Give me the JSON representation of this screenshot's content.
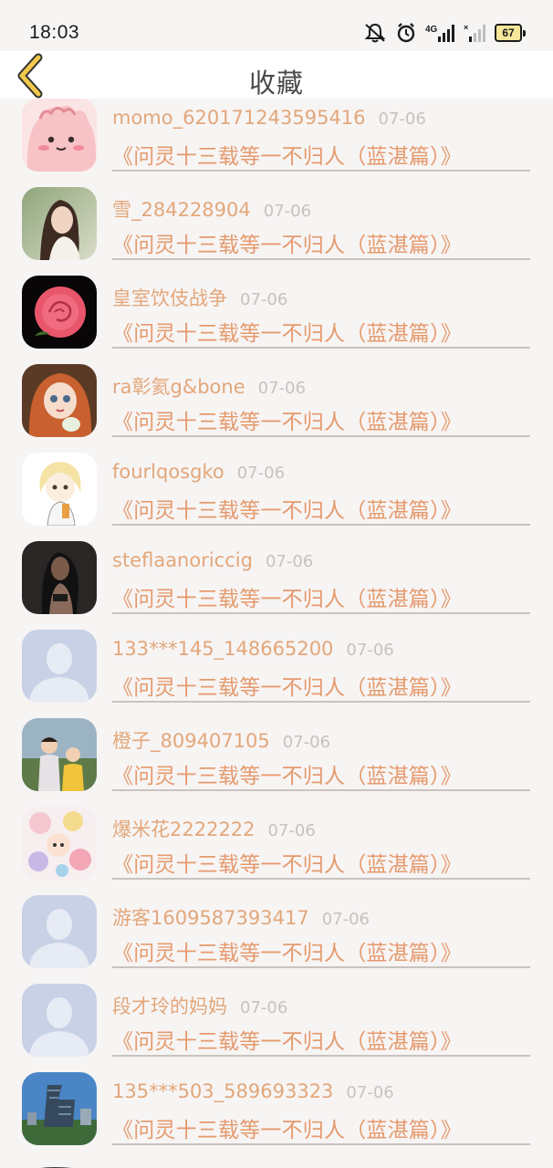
{
  "status_bar": {
    "time": "18:03",
    "battery": "67",
    "icons": [
      "mute-bell-icon",
      "alarm-icon",
      "signal-4g-icon",
      "signal-x-icon",
      "battery-icon"
    ]
  },
  "header": {
    "title": "收藏",
    "back_icon": "chevron-left-icon"
  },
  "colors": {
    "accent": "#e59a6d",
    "date": "#c7c2c0",
    "background": "#f7f4f4",
    "back_icon": "#f2c94c"
  },
  "items": [
    {
      "user": "momo_620171243595416",
      "date": "07-06",
      "title": "《问灵十三载等一不归人（蓝湛篇）》",
      "avatar": "pink-blob-avatar"
    },
    {
      "user": "雪_284228904",
      "date": "07-06",
      "title": "《问灵十三载等一不归人（蓝湛篇）》",
      "avatar": "girl-photo-avatar"
    },
    {
      "user": "皇室饮伎战争",
      "date": "07-06",
      "title": "《问灵十三载等一不归人（蓝湛篇）》",
      "avatar": "rose-avatar"
    },
    {
      "user": "ra彰氦g&bone",
      "date": "07-06",
      "title": "《问灵十三载等一不归人（蓝湛篇）》",
      "avatar": "doll-avatar"
    },
    {
      "user": "fourlqosgko",
      "date": "07-06",
      "title": "《问灵十三载等一不归人（蓝湛篇）》",
      "avatar": "cartoon-girl-avatar"
    },
    {
      "user": "steflaanoriccig",
      "date": "07-06",
      "title": "《问灵十三载等一不归人（蓝湛篇）》",
      "avatar": "dark-photo-avatar"
    },
    {
      "user": "133***145_148665200",
      "date": "07-06",
      "title": "《问灵十三载等一不归人（蓝湛篇）》",
      "avatar": "default-user-avatar"
    },
    {
      "user": "橙子_809407105",
      "date": "07-06",
      "title": "《问灵十三载等一不归人（蓝湛篇）》",
      "avatar": "kids-photo-avatar"
    },
    {
      "user": "爆米花2222222",
      "date": "07-06",
      "title": "《问灵十三载等一不归人（蓝湛篇）》",
      "avatar": "cartoon-collage-avatar"
    },
    {
      "user": "游客1609587393417",
      "date": "07-06",
      "title": "《问灵十三载等一不归人（蓝湛篇）》",
      "avatar": "default-user-avatar"
    },
    {
      "user": "段才玲的妈妈",
      "date": "07-06",
      "title": "《问灵十三载等一不归人（蓝湛篇）》",
      "avatar": "default-user-avatar"
    },
    {
      "user": "135***503_589693323",
      "date": "07-06",
      "title": "《问灵十三载等一不归人（蓝湛篇）》",
      "avatar": "building-photo-avatar"
    }
  ]
}
